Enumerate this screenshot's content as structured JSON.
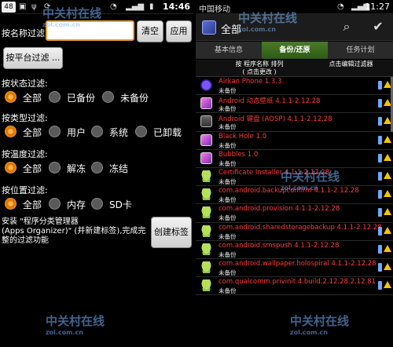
{
  "left": {
    "status": {
      "badge": "48",
      "time": "14:46"
    },
    "name_filter": {
      "label": "按名称过滤:",
      "value": "",
      "clear_label": "清空",
      "apply_label": "应用"
    },
    "platform_filter_label": "按平台过滤 ...",
    "state_filter": {
      "label": "按状态过滤:",
      "options": [
        "全部",
        "已备份",
        "未备份"
      ],
      "selected": 0
    },
    "type_filter": {
      "label": "按类型过滤:",
      "options": [
        "全部",
        "用户",
        "系统",
        "已卸载"
      ],
      "selected": 0
    },
    "temp_filter": {
      "label": "按温度过滤:",
      "options": [
        "全部",
        "解冻",
        "冻结"
      ],
      "selected": 0
    },
    "location_filter": {
      "label": "按位置过滤:",
      "options": [
        "全部",
        "内存",
        "SD卡"
      ],
      "selected": 0
    },
    "hint_lines": [
      "安装 \"程序分类管理器",
      "(Apps Organizer)\" (并新建标签),完成完",
      "整的过滤功能"
    ],
    "create_tag_label": "创建标签"
  },
  "right": {
    "status": {
      "carrier": "中国移动",
      "time": "11:27"
    },
    "title": "全部",
    "tabs": [
      "基本信息",
      "备份/还原",
      "任务计划"
    ],
    "active_tab": 1,
    "column_left": [
      "按 程序名称 排列",
      "( 点击更改 )"
    ],
    "column_right": "点击编辑过滤器",
    "apps": [
      {
        "name": "Airkan Phone 1.3.3",
        "status": "未备份",
        "icon": "circle"
      },
      {
        "name": "Android 动态壁纸 4.1.1-2.12.28",
        "status": "未备份",
        "icon": "square"
      },
      {
        "name": "Android 键盘 (AOSP) 4.1.1-2.12.28",
        "status": "未备份",
        "icon": "keyboard"
      },
      {
        "name": "Black Hole 1.0",
        "status": "未备份",
        "icon": "square"
      },
      {
        "name": "Bubbles 1.0",
        "status": "未备份",
        "icon": "square"
      },
      {
        "name": "Certificate Installer 4.1.1-2.12.28",
        "status": "未备份",
        "icon": "android"
      },
      {
        "name": "com.android.backupconfirm 4.1.1-2.12.28",
        "status": "未备份",
        "icon": "android"
      },
      {
        "name": "com.android.provision 4.1.1-2.12.28",
        "status": "未备份",
        "icon": "android"
      },
      {
        "name": "com.android.sharedstoragebackup 4.1.1-2.12.28",
        "status": "未备份",
        "icon": "android"
      },
      {
        "name": "com.android.smspush 4.1.1-2.12.28",
        "status": "未备份",
        "icon": "android"
      },
      {
        "name": "com.android.wallpaper.holospiral 4.1.1-2.12.28",
        "status": "未备份",
        "icon": "android"
      },
      {
        "name": "com.qualcomm.privinit 4.build.2.12.28.2.12.81",
        "status": "未备份",
        "icon": "android"
      }
    ]
  },
  "watermark": {
    "text": "中关村在线",
    "url": "zol.com.cn"
  },
  "colors": {
    "accent_orange": "#f0a030",
    "app_name_red": "#ff3a3a",
    "tab_green": "#3a6a1f",
    "warning_yellow": "#f5c400"
  }
}
